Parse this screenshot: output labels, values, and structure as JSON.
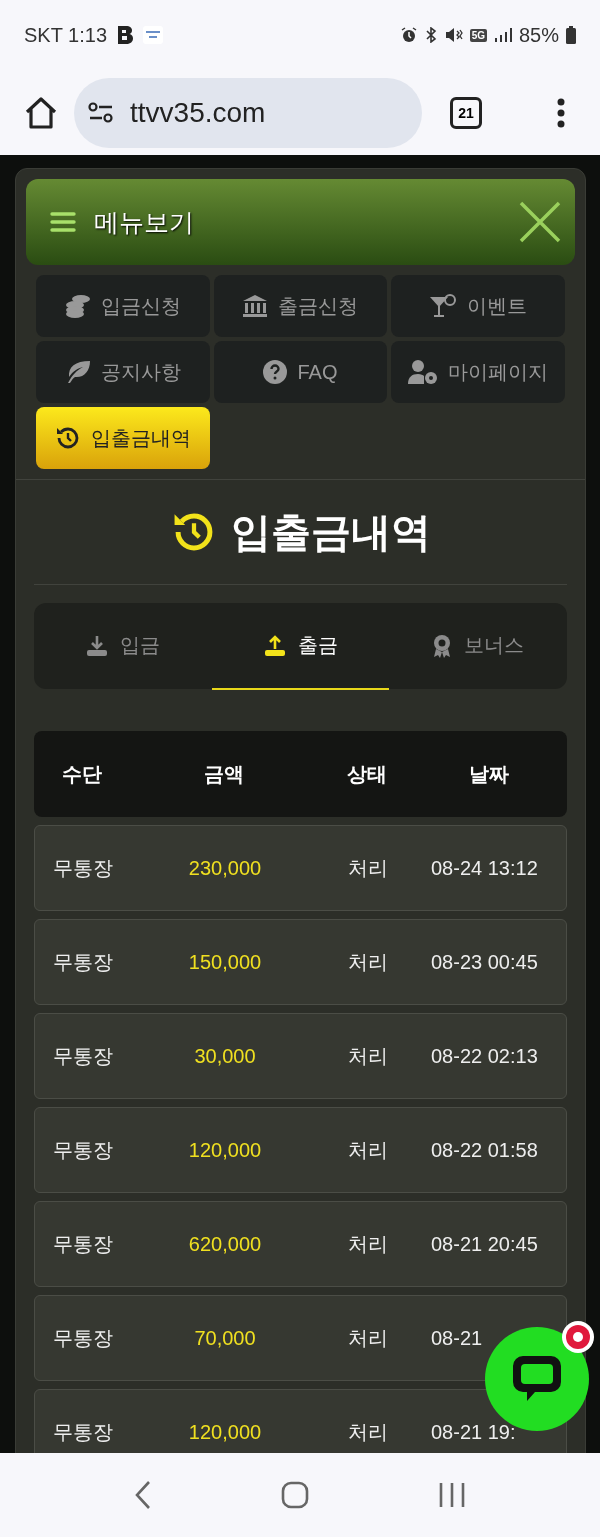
{
  "status_bar": {
    "carrier_time": "SKT 1:13",
    "network": "5G",
    "battery": "85%"
  },
  "browser": {
    "url": "ttvv35.com",
    "tab_count": "21"
  },
  "menu": {
    "title": "메뉴보기",
    "items": [
      {
        "label": "입금신청",
        "selected": false
      },
      {
        "label": "출금신청",
        "selected": false
      },
      {
        "label": "이벤트",
        "selected": false
      },
      {
        "label": "공지사항",
        "selected": false
      },
      {
        "label": "FAQ",
        "selected": false
      },
      {
        "label": "마이페이지",
        "selected": false
      },
      {
        "label": "입출금내역",
        "selected": true
      }
    ]
  },
  "page_title": "입출금내역",
  "tabs": [
    {
      "label": "입금",
      "selected": false
    },
    {
      "label": "출금",
      "selected": true
    },
    {
      "label": "보너스",
      "selected": false
    }
  ],
  "table": {
    "columns": [
      "수단",
      "금액",
      "상태",
      "날짜"
    ],
    "rows": [
      [
        "무통장",
        "230,000",
        "처리",
        "08-24 13:12"
      ],
      [
        "무통장",
        "150,000",
        "처리",
        "08-23 00:45"
      ],
      [
        "무통장",
        "30,000",
        "처리",
        "08-22 02:13"
      ],
      [
        "무통장",
        "120,000",
        "처리",
        "08-22 01:58"
      ],
      [
        "무통장",
        "620,000",
        "처리",
        "08-21 20:45"
      ],
      [
        "무통장",
        "70,000",
        "처리",
        "08-21"
      ],
      [
        "무통장",
        "120,000",
        "처리",
        "08-21 19:"
      ]
    ]
  },
  "chat": {
    "unread": true
  }
}
